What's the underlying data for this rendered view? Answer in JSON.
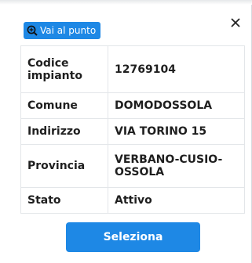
{
  "popup": {
    "goto_label": "Vai al punto",
    "close_glyph": "×",
    "rows": [
      {
        "label": "Codice impianto",
        "value": "12769104"
      },
      {
        "label": "Comune",
        "value": "DOMODOSSOLA"
      },
      {
        "label": "Indirizzo",
        "value": "VIA TORINO 15"
      },
      {
        "label": "Provincia",
        "value": "VERBANO-CUSIO-OSSOLA"
      },
      {
        "label": "Stato",
        "value": "Attivo"
      }
    ],
    "select_label": "Seleziona"
  },
  "colors": {
    "accent": "#1e88e5",
    "text": "#1f1f1f",
    "border": "#e3e6e9"
  },
  "icons": {
    "goto": "zoom-in-icon",
    "close": "close-icon"
  }
}
